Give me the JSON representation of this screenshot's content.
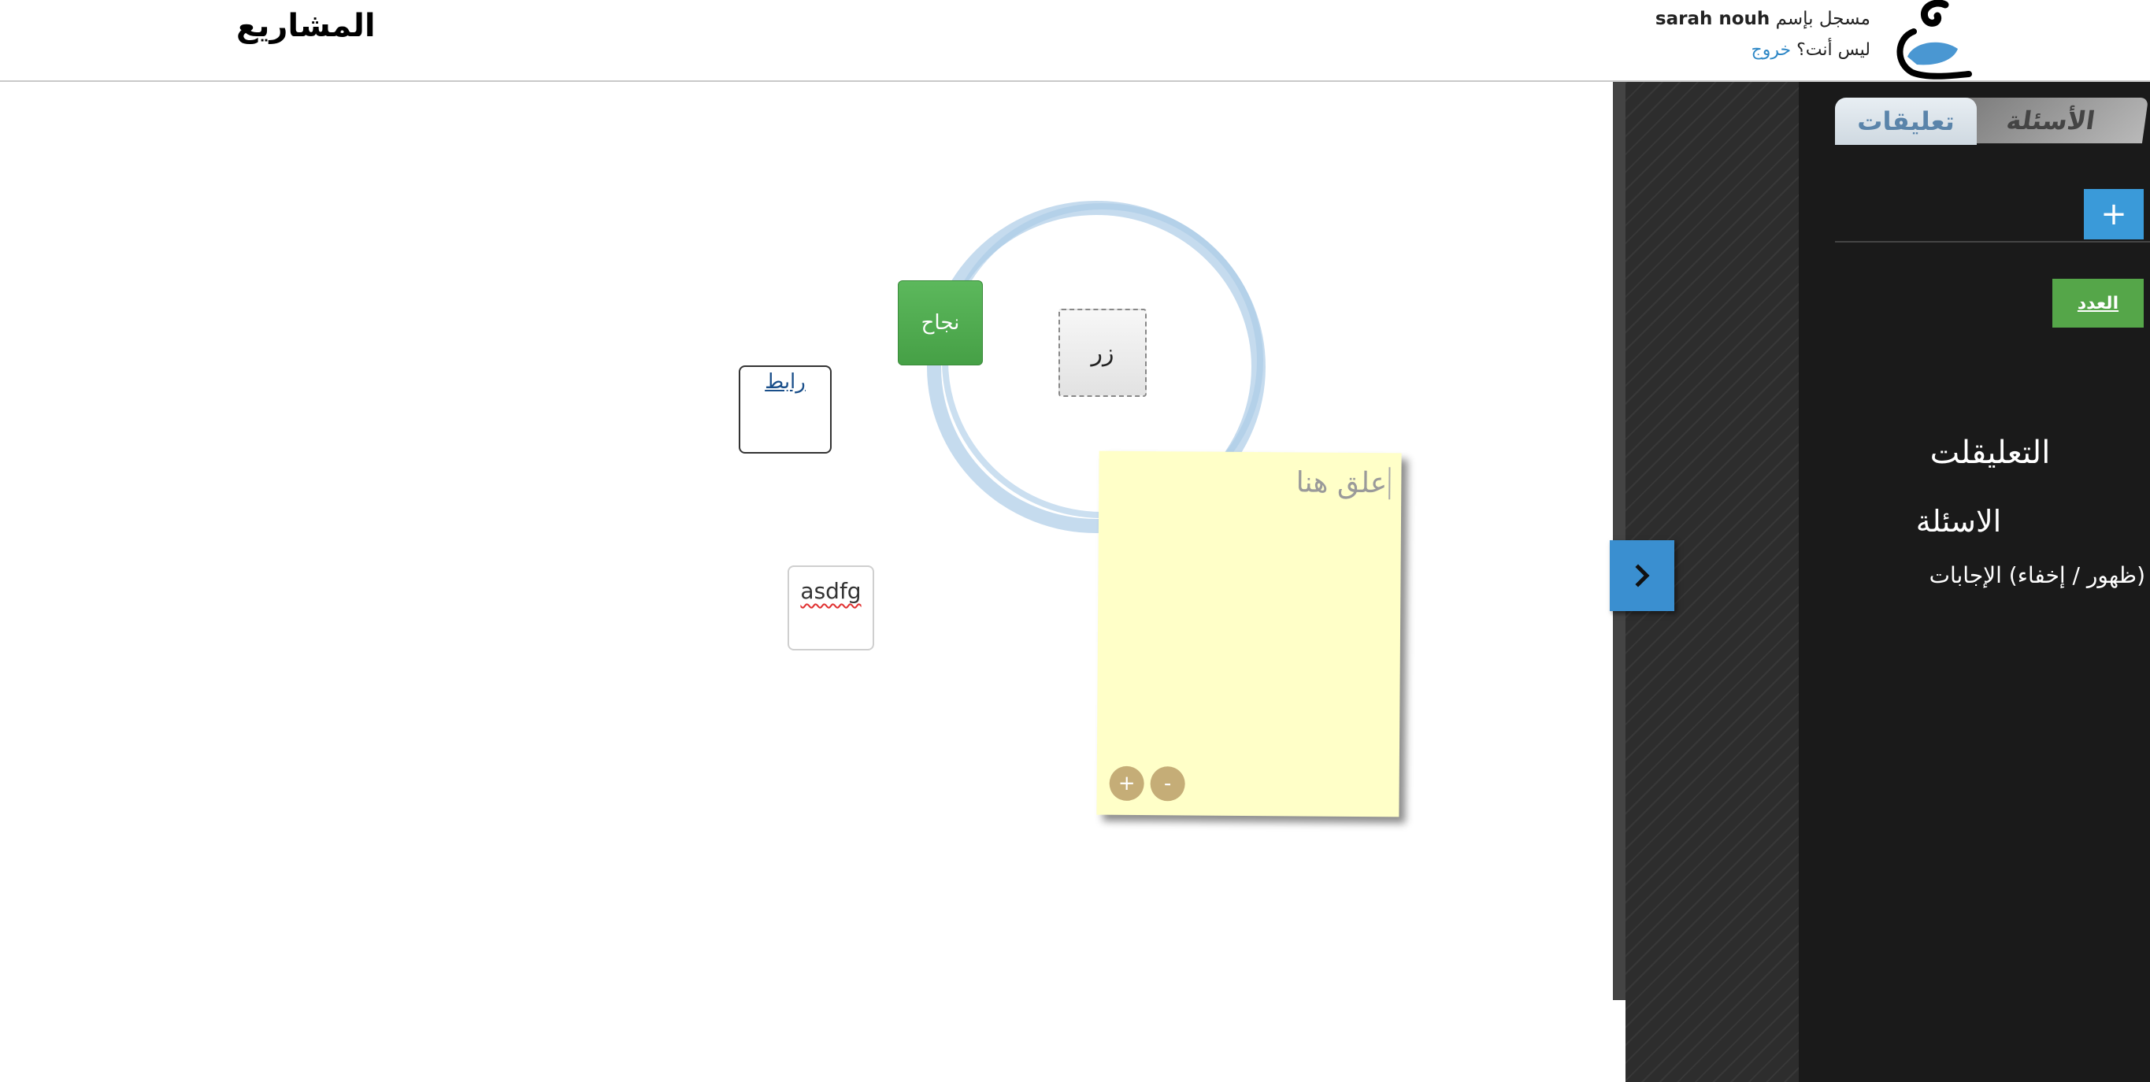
{
  "header": {
    "projects_title": "المشاريع",
    "logged_in_prefix": "مسجل بإسم",
    "username": "sarah nouh",
    "not_you_prefix": "ليس أنت؟",
    "logout_label": "خروج"
  },
  "canvas": {
    "success_button_label": "نجاح",
    "grey_button_label": "زر",
    "link_label": "رابط",
    "text_box_value": "asdfg",
    "sticky_note": {
      "placeholder": "علق هنا",
      "plus_label": "+",
      "minus_label": "-"
    }
  },
  "side_panel": {
    "tabs": {
      "questions": "الأسئلة",
      "comments": "تعليقات"
    },
    "add_label": "+",
    "count_label": "العدد",
    "comments_heading": "التعليقلت",
    "questions_heading": "الاسئلة",
    "toggle_answers_label": "(ظهور / إخفاء) الإجابات"
  },
  "colors": {
    "success_green": "#5cb85c",
    "panel_blue": "#3a9ad9",
    "count_green": "#55a649",
    "sticky_yellow": "#ffffc8",
    "circle_blue": "#b8d3ea"
  }
}
